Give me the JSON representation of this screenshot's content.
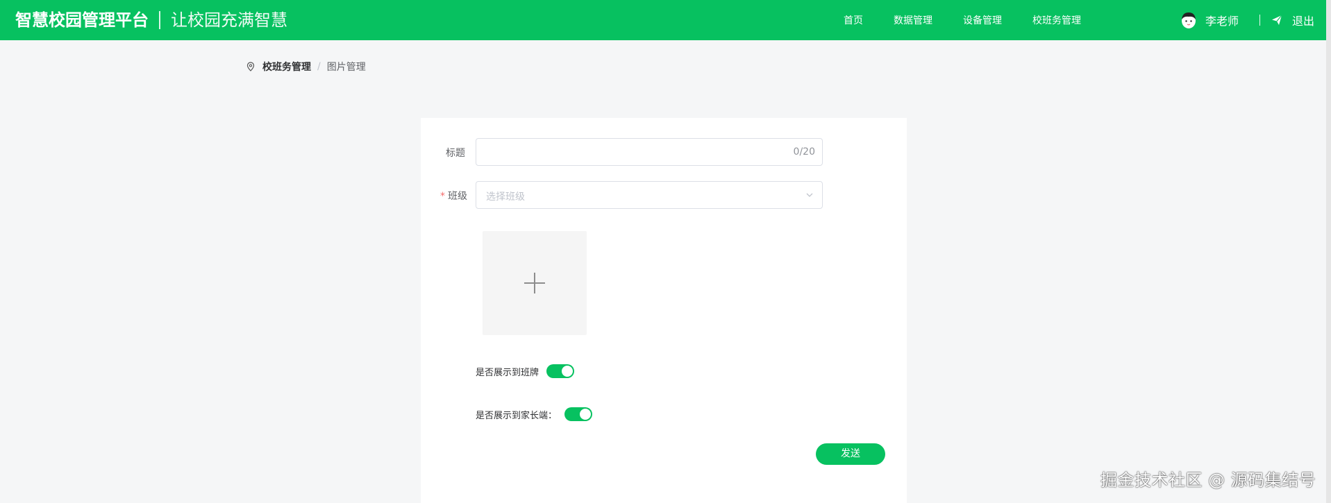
{
  "header": {
    "brand_name": "智慧校园管理平台",
    "slogan": "让校园充满智慧",
    "nav": [
      "首页",
      "数据管理",
      "设备管理",
      "校班务管理"
    ],
    "user_name": "李老师",
    "logout_label": "退出"
  },
  "breadcrumb": {
    "items": [
      "校班务管理",
      "图片管理"
    ],
    "separator": "/"
  },
  "form": {
    "title_label": "标题",
    "title_value": "",
    "title_counter": "0/20",
    "class_required_mark": "*",
    "class_label": "班级",
    "class_placeholder": "选择班级",
    "upload_icon": "plus-icon",
    "show_on_class_board_label": "是否展示到班牌",
    "show_on_class_board_on": true,
    "show_to_parents_label": "是否展示到家长端：",
    "show_to_parents_on": true,
    "send_label": "发送"
  },
  "watermark": "掘金技术社区 @ 源码集结号",
  "colors": {
    "primary": "#07c160",
    "background": "#f5f6f7",
    "required": "#f56c6c"
  }
}
